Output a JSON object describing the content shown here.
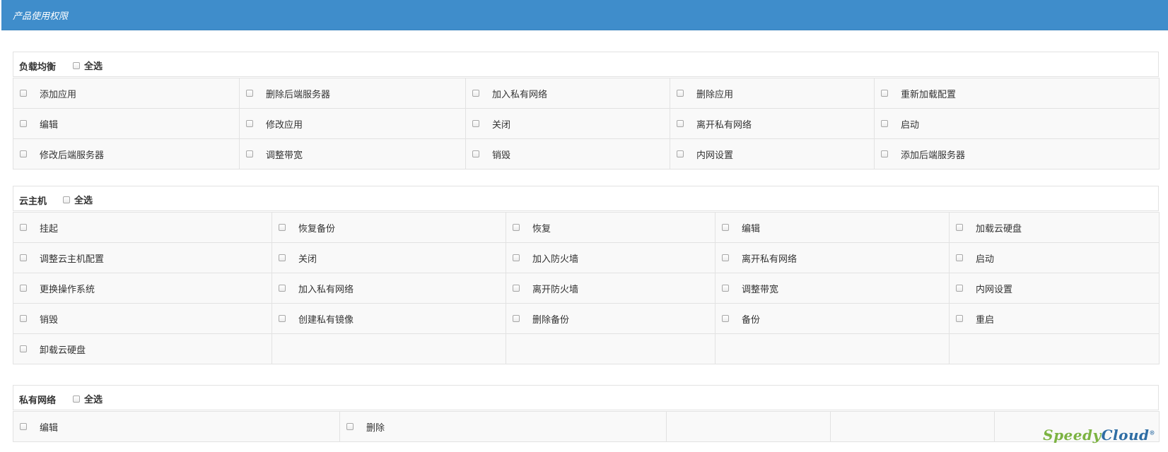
{
  "header": {
    "title": "产品使用权限"
  },
  "colors": {
    "header_bg": "#3f8dcb",
    "logo_green": "#7cb342",
    "logo_blue": "#2e6da4"
  },
  "logo": {
    "part1": "Speedy",
    "part2": "Cloud",
    "mark": "®"
  },
  "sections": [
    {
      "name": "负载均衡",
      "select_all": "全选",
      "rows": [
        [
          "添加应用",
          "删除后端服务器",
          "加入私有网络",
          "删除应用",
          "重新加载配置"
        ],
        [
          "编辑",
          "修改应用",
          "关闭",
          "离开私有网络",
          "启动"
        ],
        [
          "修改后端服务器",
          "调整带宽",
          "销毁",
          "内网设置",
          "添加后端服务器"
        ]
      ]
    },
    {
      "name": "云主机",
      "select_all": "全选",
      "rows": [
        [
          "挂起",
          "恢复备份",
          "恢复",
          "编辑",
          "加载云硬盘"
        ],
        [
          "调整云主机配置",
          "关闭",
          "加入防火墙",
          "离开私有网络",
          "启动"
        ],
        [
          "更换操作系统",
          "加入私有网络",
          "离开防火墙",
          "调整带宽",
          "内网设置"
        ],
        [
          "销毁",
          "创建私有镜像",
          "删除备份",
          "备份",
          "重启"
        ],
        [
          "卸载云硬盘",
          "",
          "",
          "",
          ""
        ]
      ]
    },
    {
      "name": "私有网络",
      "select_all": "全选",
      "rows": [
        [
          "编辑",
          "删除",
          "",
          "",
          ""
        ]
      ]
    }
  ]
}
